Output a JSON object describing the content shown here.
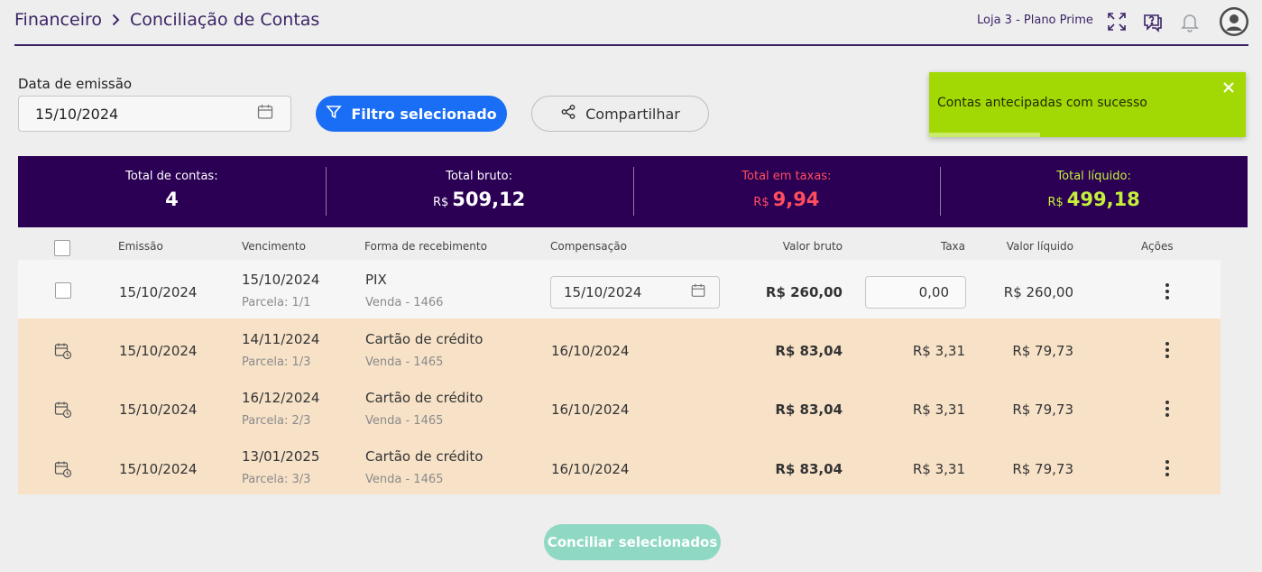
{
  "breadcrumb": {
    "parent": "Financeiro",
    "current": "Conciliação de Contas"
  },
  "header": {
    "store": "Loja 3 - Plano Prime",
    "icons": [
      "expand-icon",
      "help-chat-icon",
      "bell-icon",
      "user-avatar-icon"
    ]
  },
  "filters": {
    "date_label": "Data de emissão",
    "date_value": "15/10/2024",
    "filter_button": "Filtro selecionado",
    "share_button": "Compartilhar"
  },
  "toast": {
    "message": "Contas antecipadas com sucesso",
    "progress": 0.35,
    "color": "#a2d904"
  },
  "summary": {
    "total_contas_label": "Total de contas:",
    "total_contas_value": "4",
    "total_bruto_label": "Total bruto:",
    "total_bruto_currency": "R$",
    "total_bruto_value": "509,12",
    "total_taxas_label": "Total em taxas:",
    "total_taxas_currency": "R$",
    "total_taxas_value": "9,94",
    "total_liquido_label": "Total líquido:",
    "total_liquido_currency": "R$",
    "total_liquido_value": "499,18",
    "colors": {
      "background": "#2b0054",
      "taxas": "#ff4d5e",
      "liquido": "#c4f03a"
    }
  },
  "table": {
    "headers": {
      "emissao": "Emissão",
      "vencimento": "Vencimento",
      "forma": "Forma de recebimento",
      "compensacao": "Compensação",
      "valor_bruto": "Valor bruto",
      "taxa": "Taxa",
      "valor_liquido": "Valor líquido",
      "acoes": "Ações"
    },
    "rows": [
      {
        "emissao": "15/10/2024",
        "vencimento": "15/10/2024",
        "parcela": "Parcela: 1/1",
        "forma": "PIX",
        "venda": "Venda - 1466",
        "compensacao": "15/10/2024",
        "valor_bruto": "R$ 260,00",
        "taxa": "0,00",
        "valor_liquido": "R$ 260,00"
      },
      {
        "emissao": "15/10/2024",
        "vencimento": "14/11/2024",
        "parcela": "Parcela: 1/3",
        "forma": "Cartão de crédito",
        "venda": "Venda - 1465",
        "compensacao": "16/10/2024",
        "valor_bruto": "R$ 83,04",
        "taxa": "R$ 3,31",
        "valor_liquido": "R$ 79,73"
      },
      {
        "emissao": "15/10/2024",
        "vencimento": "16/12/2024",
        "parcela": "Parcela: 2/3",
        "forma": "Cartão de crédito",
        "venda": "Venda - 1465",
        "compensacao": "16/10/2024",
        "valor_bruto": "R$ 83,04",
        "taxa": "R$ 3,31",
        "valor_liquido": "R$ 79,73"
      },
      {
        "emissao": "15/10/2024",
        "vencimento": "13/01/2025",
        "parcela": "Parcela: 3/3",
        "forma": "Cartão de crédito",
        "venda": "Venda - 1465",
        "compensacao": "16/10/2024",
        "valor_bruto": "R$ 83,04",
        "taxa": "R$ 3,31",
        "valor_liquido": "R$ 79,73"
      }
    ]
  },
  "footer": {
    "conciliar_button": "Conciliar selecionados"
  }
}
